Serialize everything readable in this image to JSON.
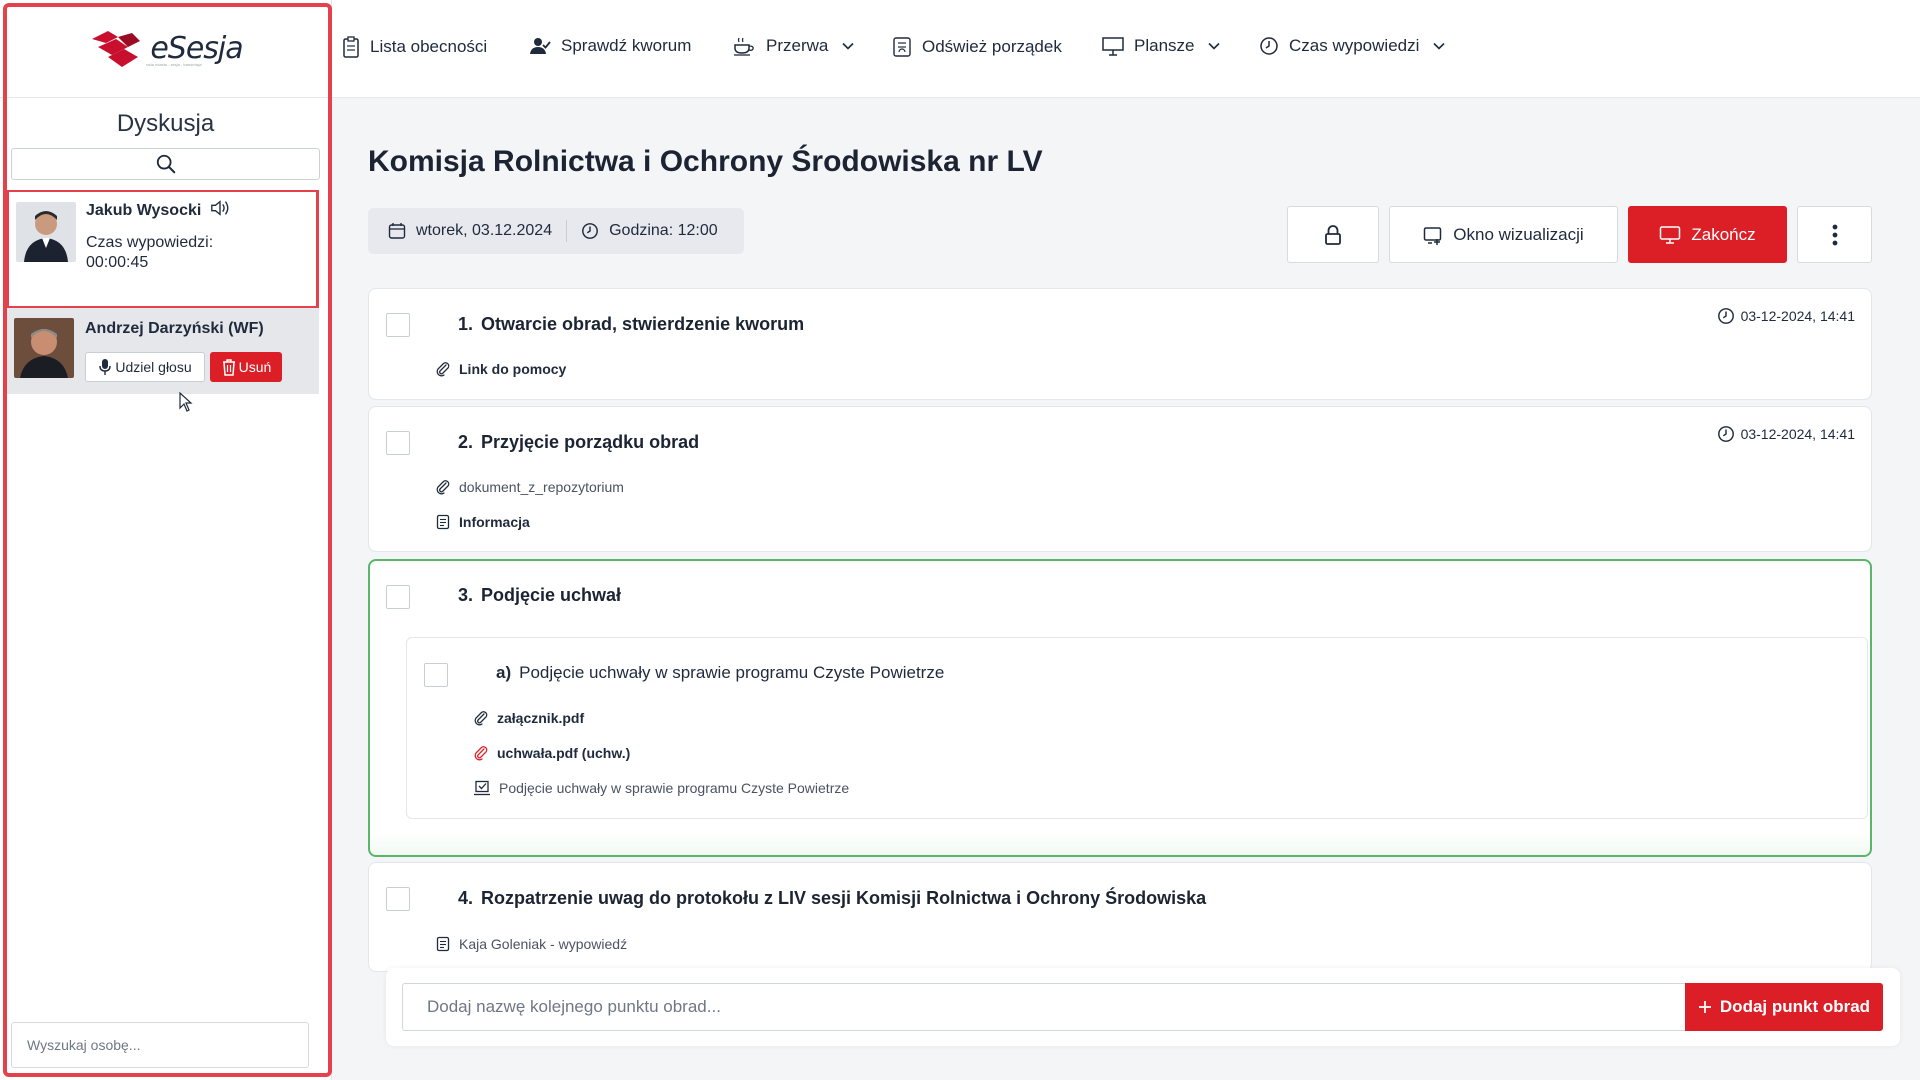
{
  "brand": {
    "name": "eSesja",
    "tagline": "rada miasta - sesja - transmisja"
  },
  "toolbar": {
    "attendance": "Lista obecności",
    "quorum": "Sprawdź kworum",
    "break": "Przerwa",
    "refresh_order": "Odśwież porządek",
    "boards": "Plansze",
    "speaking_time": "Czas wypowiedzi"
  },
  "sidebar": {
    "title": "Dyskusja",
    "active_speaker": {
      "name": "Jakub Wysocki",
      "time_label": "Czas wypowiedzi:",
      "time_value": "00:00:45"
    },
    "queue": [
      {
        "name": "Andrzej  Darzyński (WF)",
        "grant_label": "Udziel głosu",
        "remove_label": "Usuń"
      }
    ],
    "person_search_placeholder": "Wyszukaj osobę..."
  },
  "session": {
    "title": "Komisja Rolnictwa i Ochrony Środowiska nr LV",
    "date": "wtorek, 03.12.2024",
    "time": "Godzina: 12:00"
  },
  "actions": {
    "visualization_window": "Okno wizualizacji",
    "finish": "Zakończ"
  },
  "agenda": [
    {
      "number": "1.",
      "title": "Otwarcie obrad, stwierdzenie kworum",
      "timestamp": "03-12-2024, 14:41",
      "attachments": [
        {
          "label": "Link do pomocy",
          "icon": "paperclip-icon"
        }
      ]
    },
    {
      "number": "2.",
      "title": "Przyjęcie porządku obrad",
      "timestamp": "03-12-2024, 14:41",
      "attachments": [
        {
          "label": "dokument_z_repozytorium",
          "icon": "paperclip-icon"
        },
        {
          "label": "Informacja",
          "icon": "document-icon"
        }
      ]
    },
    {
      "number": "3.",
      "title": "Podjęcie uchwał",
      "subitems": [
        {
          "letter": "a)",
          "title": "Podjęcie uchwały w sprawie programu Czyste Powietrze",
          "attachments": [
            {
              "label": "załącznik.pdf",
              "icon": "paperclip-icon"
            },
            {
              "label": "uchwała.pdf (uchw.)",
              "icon": "paperclip-red-icon"
            },
            {
              "label": "Podjęcie uchwały w sprawie programu Czyste Powietrze",
              "icon": "vote-icon"
            }
          ]
        }
      ]
    },
    {
      "number": "4.",
      "title": "Rozpatrzenie uwag do protokołu z LIV sesji Komisji Rolnictwa i Ochrony Środowiska",
      "attachments": [
        {
          "label": "Kaja Goleniak - wypowiedź",
          "icon": "document-icon"
        }
      ]
    }
  ],
  "add_item": {
    "placeholder": "Dodaj nazwę kolejnego punktu obrad...",
    "button": "Dodaj punkt obrad"
  },
  "colors": {
    "accent": "#dc1f26",
    "active_border": "#5bb66c",
    "highlight_frame": "#e3414b"
  }
}
